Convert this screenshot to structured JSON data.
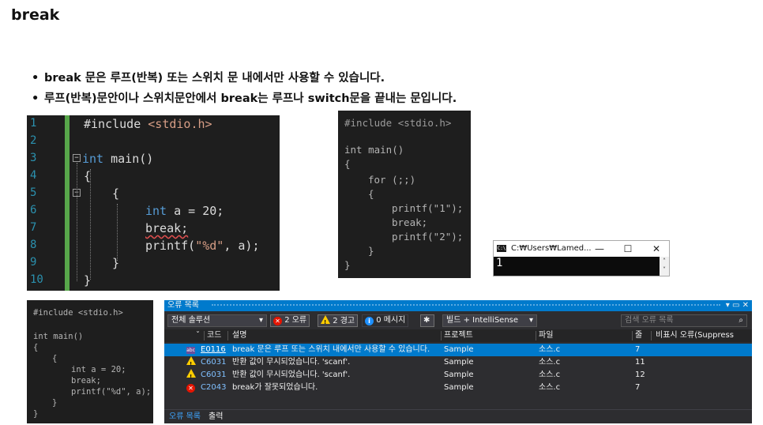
{
  "page": {
    "title": "break",
    "bullets": [
      "break 문은 루프(반복) 또는 스위치 문 내에서만 사용할 수 있습니다.",
      "루프(반복)문안이나 스위치문안에서 break는 루프나 switch문을 끝내는 문입니다."
    ],
    "bullet_mark": "•"
  },
  "editor1": {
    "line_numbers": [
      "1",
      "2",
      "3",
      "4",
      "5",
      "6",
      "7",
      "8",
      "9",
      "10"
    ],
    "include": "#include ",
    "include_file": "<stdio.h>",
    "kw_int": "int",
    "main_sig": " main()",
    "brace_open": "{",
    "brace_close": "}",
    "decl_kw": "int",
    "decl_rest": " a = 20;",
    "break_stmt": "break;",
    "printf_name": "printf(",
    "printf_fmt": "\"%d\"",
    "printf_rest": ", a);",
    "fold_minus": "−"
  },
  "editor2": {
    "include": "#include <stdio.h>",
    "int_main": "int main()",
    "brace_open": "{",
    "for_stmt": "for (;;)",
    "inner_open": "{",
    "printf1": "printf(\"1\");",
    "break_stmt": "break;",
    "printf2": "printf(\"2\");",
    "inner_close": "}",
    "brace_close": "}"
  },
  "console": {
    "icon_label": "C:\\",
    "title": "C:₩Users₩Lamed...",
    "min_icon": "—",
    "max_icon": "☐",
    "close_icon": "✕",
    "output": "1",
    "scroll_up": "˄",
    "scroll_down": "˅"
  },
  "editor3": {
    "include": "#include <stdio.h>",
    "int_main": "int main()",
    "brace_open": "{",
    "inner_open": "{",
    "decl": "int a = 20;",
    "break_stmt": "break;",
    "printf_stmt": "printf(\"%d\", a);",
    "inner_close": "}",
    "brace_close": "}"
  },
  "error_list": {
    "window_title": "오류 목록",
    "window_buttons": "▾ ▭ ✕",
    "scope": "전체 솔루션",
    "scope_arrow": "▾",
    "errors_count": "2 오류",
    "warnings_count": "2 경고",
    "messages_count": "0 메시지",
    "filter_icon": "✱",
    "build_source": "빌드 + IntelliSense",
    "build_arrow": "▾",
    "search_placeholder": "검색 오류 목록",
    "search_icon": "⌕",
    "columns": {
      "sort": "ˇ",
      "code": "코드",
      "desc": "설명",
      "project": "프로젝트",
      "file": "파일",
      "line": "줄",
      "suppress": "비표시 오류(Suppress"
    },
    "rows": [
      {
        "icon": "err",
        "icon_text": "abc",
        "code": "E0116",
        "desc": "break 문은 루프 또는 스위치 내에서만 사용할 수 있습니다.",
        "project": "Sample",
        "file": "소스.c",
        "line": "7"
      },
      {
        "icon": "warn",
        "icon_text": "!",
        "code": "C6031",
        "desc": "반환 값이 무시되었습니다. 'scanf'.",
        "project": "Sample",
        "file": "소스.c",
        "line": "11"
      },
      {
        "icon": "warn",
        "icon_text": "!",
        "code": "C6031",
        "desc": "반환 값이 무시되었습니다. 'scanf'.",
        "project": "Sample",
        "file": "소스.c",
        "line": "12"
      },
      {
        "icon": "error",
        "icon_text": "✕",
        "code": "C2043",
        "desc": "break가 잘못되었습니다.",
        "project": "Sample",
        "file": "소스.c",
        "line": "7"
      }
    ],
    "footer_tabs": [
      "오류 목록",
      "출력"
    ]
  }
}
